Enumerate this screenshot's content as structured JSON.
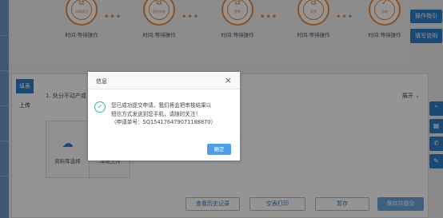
{
  "steps": [
    {
      "icon": "document-icon",
      "label": "申请填写",
      "time": "时间:等待操作"
    },
    {
      "icon": "document-icon",
      "label": "提交审核",
      "time": "时间:等待操作"
    },
    {
      "icon": "document-icon",
      "label": "受审",
      "time": "时间:等待操作"
    },
    {
      "icon": "document-icon",
      "label": "同步",
      "time": "时间:等待操作"
    },
    {
      "icon": "check-icon",
      "label": "办结",
      "time": "时间:等待操作"
    }
  ],
  "step_dots": "•••",
  "right_buttons": [
    "操作指引",
    "",
    "填写说明"
  ],
  "main": {
    "tabs": [
      "填表",
      "上传"
    ],
    "section_title": "1. 处分不动产或",
    "expand_label": "展开 ⌄",
    "upload": {
      "left_label": "资料库选择",
      "right_label": "本地上传"
    }
  },
  "bottom_buttons": {
    "history": "查看历史记录",
    "print": "空表打印",
    "save": "暂存",
    "submit": "保存并提交"
  },
  "dialog": {
    "title": "信息",
    "close": "×",
    "message_lines": [
      "您已成功提交申请，我们将会把审核结果以",
      "短信方式发送到您手机，请随时关注！",
      "（申请单号：SQ154176479071188870）"
    ],
    "ok": "确定"
  },
  "colors": {
    "accent": "#2b7fc9",
    "step_orange": "#f08c3c",
    "success": "#2db79e",
    "ok_button": "#4a9fe8"
  }
}
